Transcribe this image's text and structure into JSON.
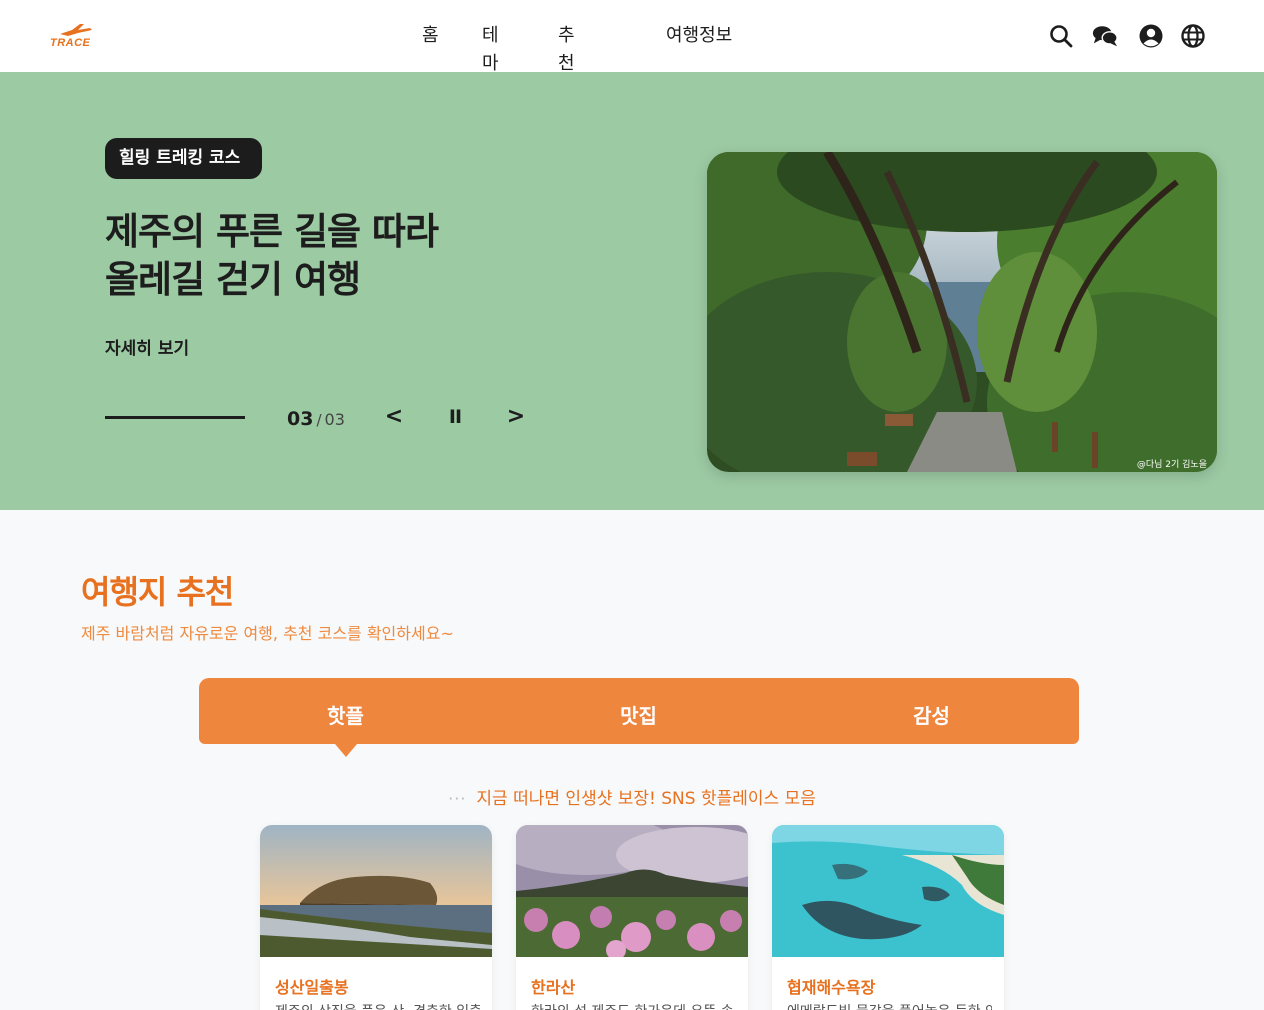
{
  "header": {
    "logo_text": "TRACE",
    "nav": [
      "홈",
      "테마",
      "추천코스",
      "여행정보"
    ],
    "icons": [
      "search-icon",
      "chat-icon",
      "user-icon",
      "globe-icon"
    ]
  },
  "hero": {
    "badge": "힐링 트레킹 코스",
    "title_line1": "제주의 푸른 길을 따라",
    "title_line2": "올레길 걷기 여행",
    "more_label": "자세히 보기",
    "progress": 1.0,
    "counter_current": "03",
    "counter_sep": "/",
    "counter_total": "03",
    "prev_label": "<",
    "pause_label": "II",
    "next_label": ">",
    "image_credit": "@다님 2기 김노을",
    "background_color": "#9ccaa3"
  },
  "section": {
    "title": "여행지 추천",
    "subtitle": "제주 바람처럼 자유로운 여행, 추천 코스를 확인하세요~",
    "tabs": [
      "핫플",
      "맛집",
      "감성"
    ],
    "active_tab": "핫플",
    "tagline_dots": "···",
    "tagline": "지금 떠나면 인생샷 보장! SNS 핫플레이스 모음",
    "accent_color": "#ef863e"
  },
  "cards": [
    {
      "title": "성산일출봉",
      "desc": "제주의 상징을 품은 산, 경충한 일출"
    },
    {
      "title": "한라산",
      "desc": "한라의 섬 제주도 한가운데 우뚝 솟"
    },
    {
      "title": "협재해수욕장",
      "desc": "에메랄드빛 물감을 풀어놓은 듯한 연"
    }
  ]
}
